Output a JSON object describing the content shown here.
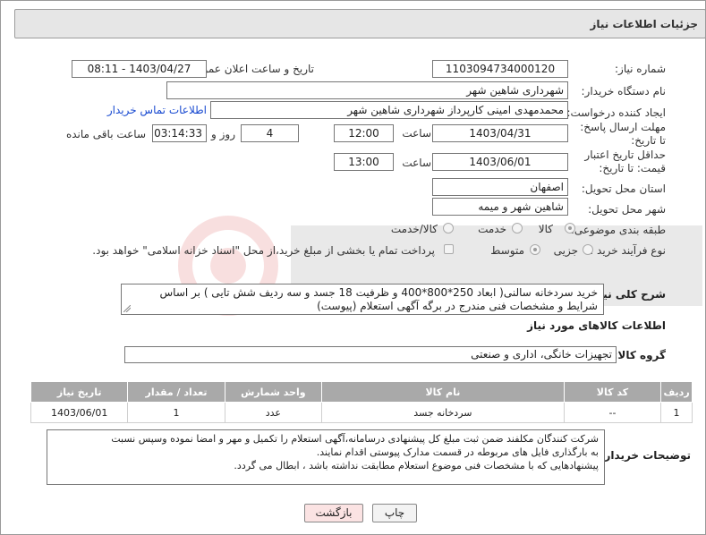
{
  "header": {
    "title": "جزئیات اطلاعات نیاز"
  },
  "fields": {
    "need_number": {
      "label": "شماره نیاز:",
      "value": "1103094734000120"
    },
    "announce_datetime": {
      "label": "تاریخ و ساعت اعلان عمومی:",
      "value": "1403/04/27 - 08:11"
    },
    "buyer_org": {
      "label": "نام دستگاه خریدار:",
      "value": "شهرداری شاهین شهر"
    },
    "requester": {
      "label": "ایجاد کننده درخواست:",
      "value": "محمدمهدی امینی کارپرداز شهرداری شاهین شهر",
      "contact_link": "اطلاعات تماس خریدار"
    },
    "reply_deadline": {
      "label": "مهلت ارسال پاسخ: تا تاریخ:",
      "date": "1403/04/31",
      "time_label": "ساعت",
      "time": "12:00",
      "days": "4",
      "days_label": "روز و",
      "remaining": "03:14:33",
      "remaining_label": "ساعت باقی مانده"
    },
    "price_validity": {
      "label": "حداقل تاریخ اعتبار قیمت: تا تاریخ:",
      "date": "1403/06/01",
      "time_label": "ساعت",
      "time": "13:00"
    },
    "province": {
      "label": "استان محل تحویل:",
      "value": "اصفهان"
    },
    "city": {
      "label": "شهر محل تحویل:",
      "value": "شاهین شهر و میمه"
    },
    "category": {
      "label": "طبقه بندی موضوعی:",
      "options": [
        "کالا",
        "خدمت",
        "کالا/خدمت"
      ],
      "selected": "کالا"
    },
    "purchase_type": {
      "label": "نوع فرآیند خرید :",
      "options": [
        "جزیی",
        "متوسط"
      ],
      "selected": "متوسط",
      "payment_note": "پرداخت تمام یا بخشی از مبلغ خرید،از محل \"اسناد خزانه اسلامی\" خواهد بود."
    }
  },
  "summary": {
    "label": "شرح کلی نیاز:",
    "value": "خرید سردخانه سالنی( ابعاد 250*800*400 و ظرفیت 18 جسد و سه ردیف شش تایی ) بر اساس شرایط و مشخصات فنی مندرج در برگه آگهی استعلام (پیوست)"
  },
  "goods": {
    "section_title": "اطلاعات کالاهای مورد نیاز",
    "group_label": "گروه کالا:",
    "group_value": "تجهیزات خانگی، اداری و صنعتی",
    "columns": [
      "ردیف",
      "کد کالا",
      "نام کالا",
      "واحد شمارش",
      "تعداد / مقدار",
      "تاریخ نیاز"
    ],
    "rows": [
      [
        "1",
        "--",
        "سردخانه جسد",
        "عدد",
        "1",
        "1403/06/01"
      ]
    ]
  },
  "buyer_notes": {
    "label": "توضیحات خریدار:",
    "lines": [
      "شرکت کنندگان مکلفند ضمن ثبت مبلغ کل پیشنهادی درسامانه،آگهی استعلام را  تکمیل و مهر و امضا نموده وسپس نسبت",
      "به بارگذاری فایل های مربوطه در قسمت مدارک پیوستی اقدام نمایند.",
      "پیشنهادهایی که با مشخصات فنی موضوع استعلام مطابقت نداشته باشد ، ابطال می گردد."
    ]
  },
  "buttons": {
    "print": "چاپ",
    "back": "بازگشت"
  },
  "colors": {
    "link": "#1a4bd1",
    "table_header": "#a9a9a9",
    "back_button": "#fbe3e3"
  }
}
